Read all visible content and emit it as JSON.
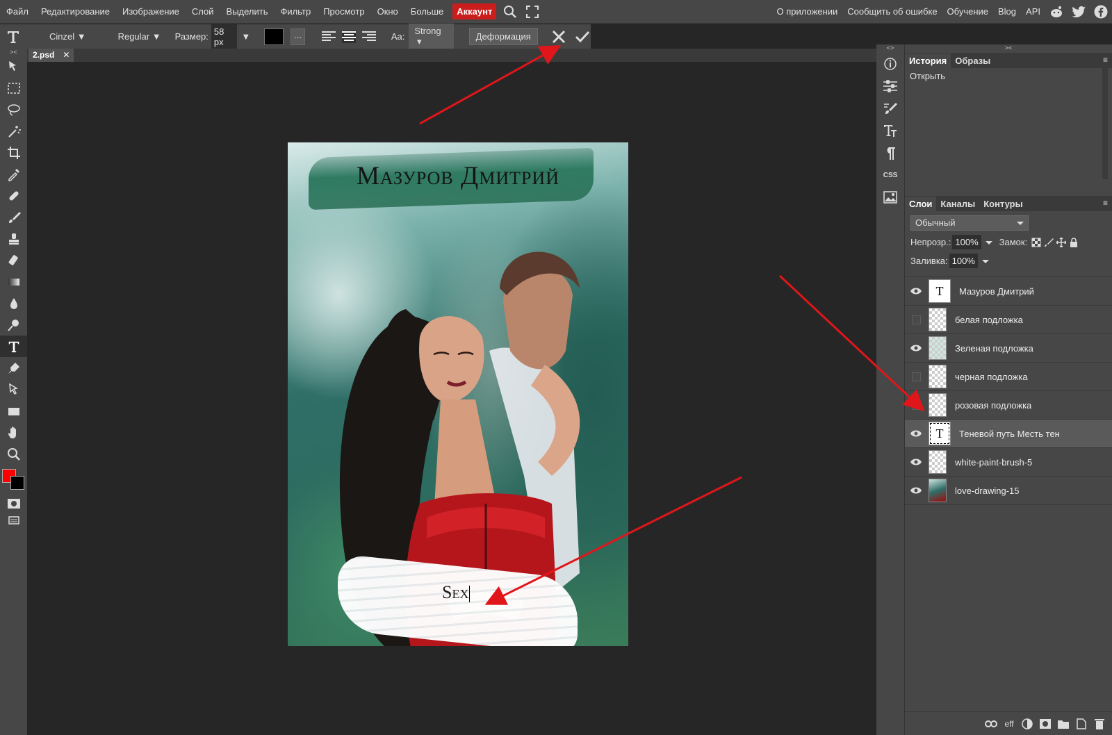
{
  "menubar": {
    "items": [
      "Файл",
      "Редактирование",
      "Изображение",
      "Слой",
      "Выделить",
      "Фильтр",
      "Просмотр",
      "Окно",
      "Больше"
    ],
    "account": "Аккаунт",
    "right": [
      "О приложении",
      "Сообщить об ошибке",
      "Обучение",
      "Blog",
      "API"
    ]
  },
  "options": {
    "font": "Cinzel ▼",
    "style": "Regular ▼",
    "size_label": "Размер:",
    "size_value": "58 px",
    "color": "#000000",
    "dots": "...",
    "aa_label": "Aa:",
    "aa_value": "Strong",
    "warp_button": "Деформация"
  },
  "document": {
    "tab": "2.psd",
    "tab_close": "✕",
    "author": "Мазуров Дмитрий",
    "subtitle": "Sex"
  },
  "colors": {
    "foreground": "#ff0000",
    "background": "#000000",
    "accent": "#cc1d1d",
    "arrow": "#e0161a"
  },
  "history": {
    "tabs": [
      "История",
      "Образы"
    ],
    "items": [
      "Открыть"
    ]
  },
  "layers": {
    "tabs": [
      "Слои",
      "Каналы",
      "Контуры"
    ],
    "blend_mode": "Обычный",
    "opacity_label": "Непрозр.:",
    "opacity": "100%",
    "lock_label": "Замок:",
    "fill_label": "Заливка:",
    "fill": "100%",
    "items": [
      {
        "name": "Мазуров Дмитрий",
        "visible": true,
        "kind": "text"
      },
      {
        "name": "белая подложка",
        "visible": false,
        "kind": "raster"
      },
      {
        "name": "Зеленая подложка",
        "visible": true,
        "kind": "raster"
      },
      {
        "name": "черная подложка",
        "visible": false,
        "kind": "raster"
      },
      {
        "name": "розовая подложка",
        "visible": false,
        "kind": "raster"
      },
      {
        "name": "Теневой путь Месть тен",
        "visible": true,
        "kind": "text",
        "selected": true
      },
      {
        "name": "white-paint-brush-5",
        "visible": true,
        "kind": "raster"
      },
      {
        "name": "love-drawing-15",
        "visible": true,
        "kind": "image"
      }
    ]
  }
}
